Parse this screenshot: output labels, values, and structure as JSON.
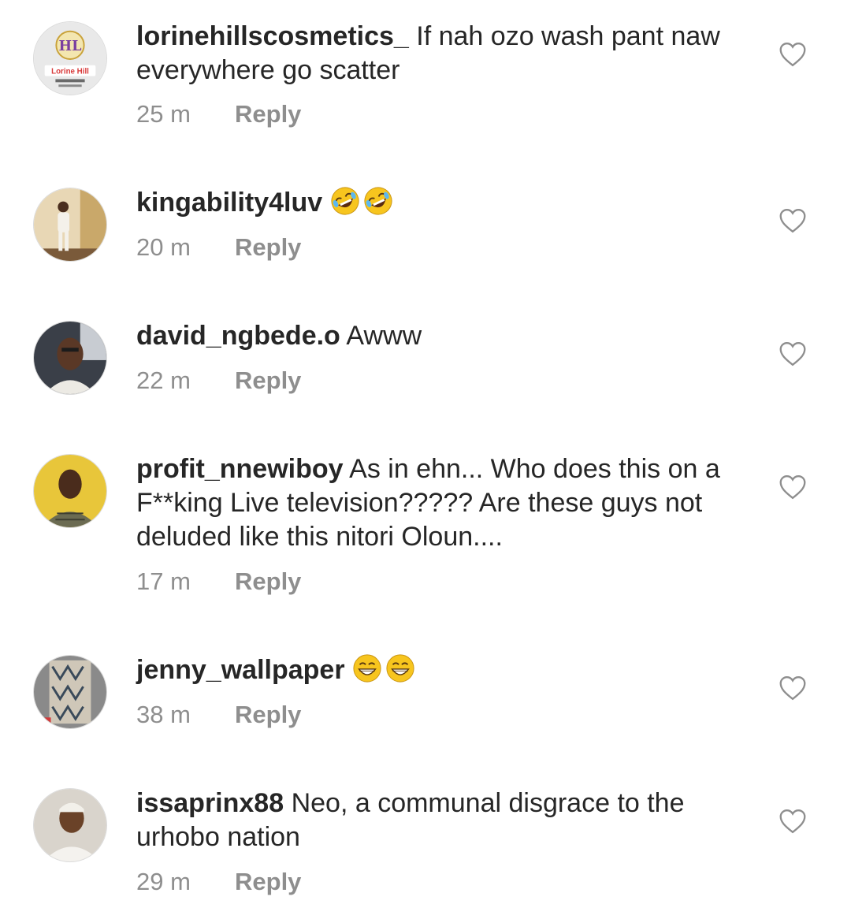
{
  "comments": [
    {
      "username": "lorinehillscosmetics_",
      "text": "If nah ozo wash pant naw everywhere go scatter",
      "time": "25 m",
      "reply": "Reply",
      "avatar_text": "Lorine Hill"
    },
    {
      "username": "kingability4luv",
      "text": "",
      "emoji": "rolling-on-floor-laughing-emoji",
      "time": "20 m",
      "reply": "Reply"
    },
    {
      "username": "david_ngbede.o",
      "text": "Awww",
      "time": "22 m",
      "reply": "Reply"
    },
    {
      "username": "profit_nnewiboy",
      "text": "As in ehn... Who does this on a F**king Live television????? Are these guys not deluded like this nitori Oloun....",
      "time": "17 m",
      "reply": "Reply"
    },
    {
      "username": "jenny_wallpaper",
      "text": "",
      "emoji": "grinning-face-emoji",
      "time": "38 m",
      "reply": "Reply"
    },
    {
      "username": "issaprinx88",
      "text": "Neo, a communal disgrace to the urhobo nation",
      "time": "29 m",
      "reply": "Reply"
    }
  ],
  "colors": {
    "text": "#262626",
    "meta": "#8e8e8e",
    "heart": "#8e8e8e",
    "emoji_face": "#f7c51e"
  }
}
